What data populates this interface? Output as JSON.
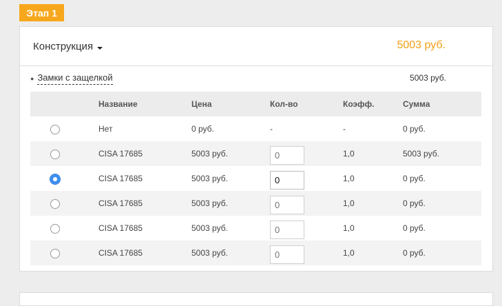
{
  "stage": {
    "label": "Этап 1"
  },
  "section": {
    "title": "Конструкция",
    "price": "5003 руб."
  },
  "subgroup": {
    "label": "Замки с защелкой",
    "price": "5003 руб."
  },
  "table": {
    "headers": {
      "name": "Название",
      "price": "Цена",
      "qty": "Кол-во",
      "coef": "Коэфф.",
      "sum": "Сумма"
    },
    "rows": [
      {
        "name": "Нет",
        "price": "0 руб.",
        "qty": "-",
        "coef": "-",
        "sum": "0 руб.",
        "selected": false
      },
      {
        "name": "CISA 17685",
        "price": "5003 руб.",
        "qty_value": "",
        "qty_placeholder": "0",
        "coef": "1,0",
        "sum": "5003 руб.",
        "selected": false
      },
      {
        "name": "CISA 17685",
        "price": "5003 руб.",
        "qty_value": "0",
        "qty_placeholder": "0",
        "coef": "1,0",
        "sum": "0 руб.",
        "selected": true
      },
      {
        "name": "CISA 17685",
        "price": "5003 руб.",
        "qty_value": "",
        "qty_placeholder": "0",
        "coef": "1,0",
        "sum": "0 руб.",
        "selected": false
      },
      {
        "name": "CISA 17685",
        "price": "5003 руб.",
        "qty_value": "",
        "qty_placeholder": "0",
        "coef": "1,0",
        "sum": "0 руб.",
        "selected": false
      },
      {
        "name": "CISA 17685",
        "price": "5003 руб.",
        "qty_value": "",
        "qty_placeholder": "0",
        "coef": "1,0",
        "sum": "0 руб.",
        "selected": false
      }
    ]
  },
  "colors": {
    "accent": "#f7a71c",
    "price_accent": "#f0a019",
    "radio_selected": "#3b8ef2"
  }
}
